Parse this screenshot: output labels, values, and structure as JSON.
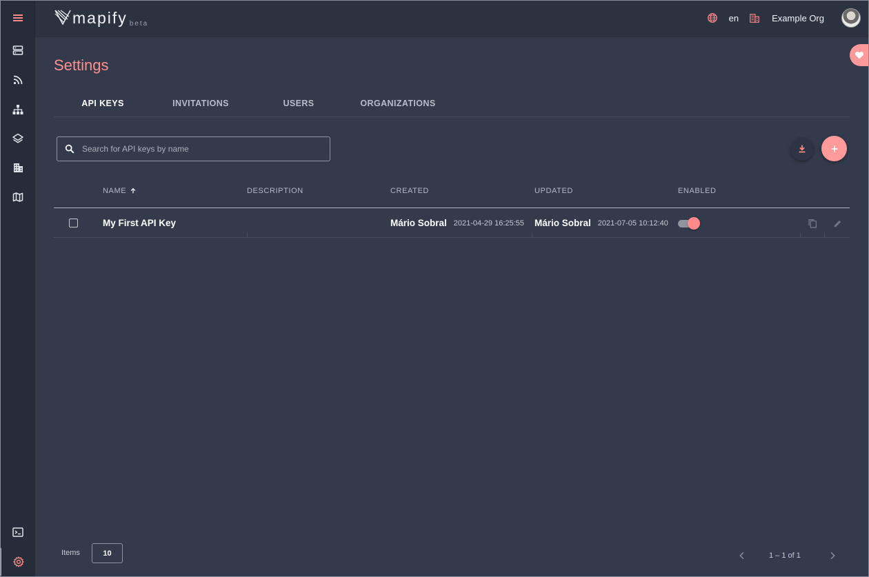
{
  "app": {
    "logo_text": "mapify",
    "logo_badge": "beta"
  },
  "header": {
    "language": "en",
    "organization": "Example Org"
  },
  "sidebar": {
    "items": [
      {
        "name": "menu",
        "icon": "hamburger-icon"
      },
      {
        "name": "servers",
        "icon": "server-icon"
      },
      {
        "name": "feeds",
        "icon": "rss-icon"
      },
      {
        "name": "hierarchy",
        "icon": "sitemap-icon"
      },
      {
        "name": "layers",
        "icon": "layers-icon"
      },
      {
        "name": "buildings",
        "icon": "building-icon"
      },
      {
        "name": "maps",
        "icon": "map-icon"
      },
      {
        "name": "terminal",
        "icon": "terminal-icon"
      },
      {
        "name": "settings",
        "icon": "gear-icon",
        "active": true
      }
    ]
  },
  "page": {
    "title": "Settings"
  },
  "tabs": [
    {
      "label": "API KEYS",
      "active": true
    },
    {
      "label": "INVITATIONS"
    },
    {
      "label": "USERS"
    },
    {
      "label": "ORGANIZATIONS"
    }
  ],
  "search": {
    "placeholder": "Search for API keys by name"
  },
  "table": {
    "columns": {
      "name": "NAME",
      "description": "DESCRIPTION",
      "created": "CREATED",
      "updated": "UPDATED",
      "enabled": "ENABLED"
    },
    "rows": [
      {
        "name": "My First API Key",
        "description": "",
        "created_by": "Mário Sobral",
        "created_at": "2021-04-29 16:25:55",
        "updated_by": "Mário Sobral",
        "updated_at": "2021-07-05 10:12:40",
        "enabled": true
      }
    ]
  },
  "footer": {
    "items_label": "Items",
    "items_per_page": "10",
    "pager_range": "1 – 1 of 1"
  },
  "colors": {
    "accent": "#ff8a8a",
    "background": "#333a4b",
    "sidebar": "#262d3a",
    "header": "#2b3240"
  }
}
